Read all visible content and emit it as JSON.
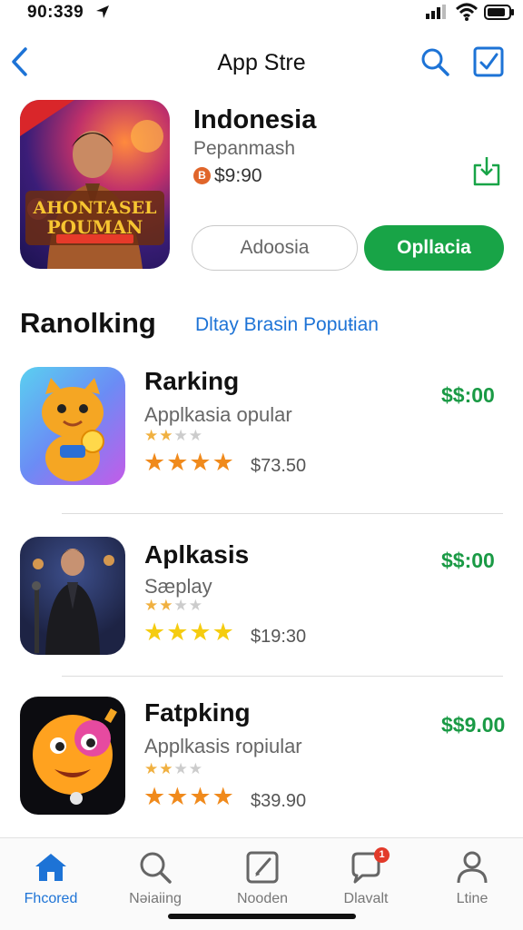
{
  "status_bar": {
    "time": "90:339"
  },
  "nav": {
    "title": "App Stre"
  },
  "featured": {
    "art_title_line1": "AHONTASEL",
    "art_title_line2": "POUMAN",
    "title": "Indonesia",
    "subtitle": "Pepanmash",
    "coin_label": "B",
    "price": "$9:90",
    "secondary_button": "Adoosia",
    "primary_button": "Opllacia"
  },
  "section": {
    "title": "Ranolking",
    "link": "Dltay Brasin Popuŧian"
  },
  "apps": [
    {
      "title": "Rarking",
      "subtitle": "Applkasia opular",
      "price": "$$:00",
      "amount": "$73.50"
    },
    {
      "title": "Aplkasis",
      "subtitle": "Sæplay",
      "price": "$$:00",
      "amount": "$19:30"
    },
    {
      "title": "Fatpking",
      "subtitle": "Applkasis ropiular",
      "price": "$$9.00",
      "amount": "$39.90"
    }
  ],
  "tabs": [
    {
      "label": "Fhcored",
      "icon": "house-icon",
      "active": true
    },
    {
      "label": "Nəiaiing",
      "icon": "search-icon"
    },
    {
      "label": "Nooden",
      "icon": "edit-icon"
    },
    {
      "label": "Dlavalt",
      "icon": "chat-icon",
      "badge": "1"
    },
    {
      "label": "Ltine",
      "icon": "person-icon"
    }
  ],
  "colors": {
    "accent": "#1d73d6",
    "green": "#18a447",
    "star": "#f0a020"
  }
}
